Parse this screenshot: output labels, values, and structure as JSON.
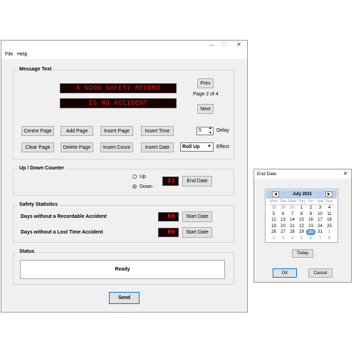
{
  "main": {
    "menu": [
      "File",
      "Help"
    ],
    "groups": {
      "message": "Message Text",
      "counter": "Up / Down Counter",
      "stats": "Safety Statistics",
      "status": "Status"
    },
    "led_lines": [
      "A GOOD SAFETY RECORD",
      "IS NO ACCIDENT"
    ],
    "prev": "Prev",
    "next": "Next",
    "page_info": "Page 2 of 4",
    "buttons_row1": [
      "Centre Page",
      "Add Page",
      "Insert Page",
      "Insert Time"
    ],
    "buttons_row2": [
      "Clear Page",
      "Delete Page",
      "Insert Count",
      "Insert Date"
    ],
    "delay_value": "5",
    "delay_label": "Delay",
    "effect_value": "Roll Up",
    "effect_label": "Effect",
    "counter": {
      "up": "Up",
      "down": "Down",
      "selected": "Down",
      "value": "21",
      "button": "End Date"
    },
    "stats": {
      "row1_label": "Days without a Recordable Accident",
      "row1_value": "00",
      "row2_label": "Days without a Lost Time Accident",
      "row2_value": "00",
      "start_date": "Start Date"
    },
    "status_text": "Ready",
    "send": "Send"
  },
  "end_date_dialog": {
    "title": "End Date",
    "close": "✕",
    "month": "July 2021",
    "weekdays": [
      "Mon",
      "Tue",
      "Wed",
      "Thu",
      "Fri",
      "Sat",
      "Sun"
    ],
    "weeks": [
      [
        "28",
        "29",
        "30",
        "1",
        "2",
        "3",
        "4"
      ],
      [
        "5",
        "6",
        "7",
        "8",
        "9",
        "10",
        "11"
      ],
      [
        "12",
        "13",
        "14",
        "15",
        "16",
        "17",
        "18"
      ],
      [
        "19",
        "20",
        "21",
        "22",
        "23",
        "24",
        "25"
      ],
      [
        "26",
        "27",
        "28",
        "29",
        "30",
        "31",
        "1"
      ],
      [
        "2",
        "3",
        "4",
        "5",
        "6",
        "7",
        "8"
      ]
    ],
    "selected_day": "30",
    "today": "Today",
    "ok": "OK",
    "cancel": "Cancel"
  },
  "colors": {
    "led_text": "#ff1a1a",
    "led_bg": "#1a0000",
    "calendar_header": "#b9d1ea",
    "selection": "#0078d7"
  }
}
